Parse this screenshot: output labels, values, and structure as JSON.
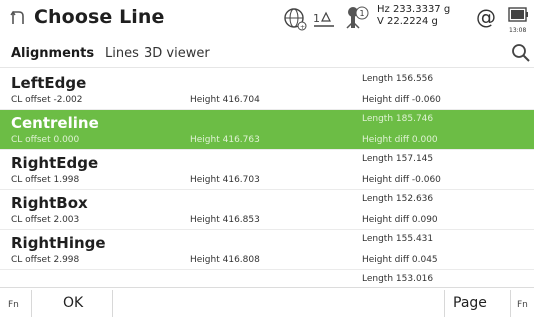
{
  "header": {
    "title": "Choose Line",
    "angles": {
      "hz": "Hz 233.3337 g",
      "v": "V  22.2224 g"
    },
    "at_symbol": "@",
    "clock": "13:08"
  },
  "tabs": [
    {
      "label": "Alignments",
      "active": true
    },
    {
      "label": "Lines",
      "active": false
    },
    {
      "label": "3D viewer",
      "active": false
    }
  ],
  "rows": [
    {
      "name": "LeftEdge",
      "offset": "CL offset  -2.002",
      "height": "Height  416.704",
      "length": "Length  156.556",
      "hdiff": "Height diff  -0.060",
      "selected": false
    },
    {
      "name": "Centreline",
      "offset": "CL offset  0.000",
      "height": "Height  416.763",
      "length": "Length  185.746",
      "hdiff": "Height diff  0.000",
      "selected": true
    },
    {
      "name": "RightEdge",
      "offset": "CL offset  1.998",
      "height": "Height  416.703",
      "length": "Length  157.145",
      "hdiff": "Height diff  -0.060",
      "selected": false
    },
    {
      "name": "RightBox",
      "offset": "CL offset  2.003",
      "height": "Height  416.853",
      "length": "Length  152.636",
      "hdiff": "Height diff  0.090",
      "selected": false
    },
    {
      "name": "RightHinge",
      "offset": "CL offset  2.998",
      "height": "Height  416.808",
      "length": "Length  155.431",
      "hdiff": "Height diff  0.045",
      "selected": false
    }
  ],
  "partial_row": {
    "length": "Length  153.016"
  },
  "softkeys": {
    "fn_left": "Fn",
    "ok": "OK",
    "page": "Page",
    "fn_right": "Fn"
  },
  "colors": {
    "selection": "#6cbd45"
  },
  "icons": [
    "back-icon",
    "globe-icon",
    "compensator-icon",
    "prism-icon",
    "battery-icon",
    "search-icon"
  ]
}
